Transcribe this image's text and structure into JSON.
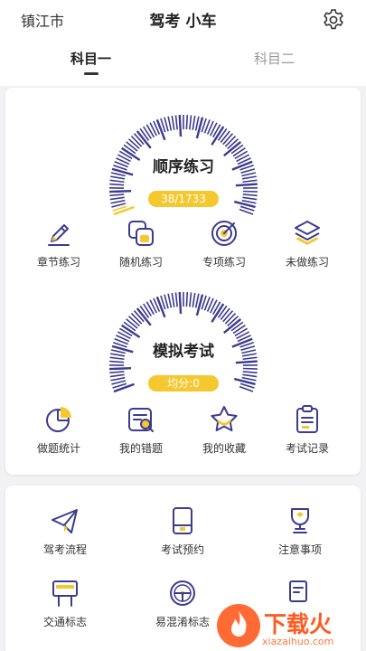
{
  "header": {
    "city": "镇江市",
    "title": "驾考 小车"
  },
  "tabs": [
    {
      "label": "科目一"
    },
    {
      "label": "科目二"
    }
  ],
  "practice": {
    "gauge_label": "顺序练习",
    "progress_text": "38/1733",
    "progress_fraction": 0.022,
    "items": [
      {
        "label": "章节练习"
      },
      {
        "label": "随机练习"
      },
      {
        "label": "专项练习"
      },
      {
        "label": "未做练习"
      }
    ]
  },
  "exam": {
    "gauge_label": "模拟考试",
    "score_text": "均分:0",
    "items": [
      {
        "label": "做题统计"
      },
      {
        "label": "我的错题"
      },
      {
        "label": "我的收藏"
      },
      {
        "label": "考试记录"
      }
    ]
  },
  "tools": {
    "items": [
      {
        "label": "驾考流程"
      },
      {
        "label": "考试预约"
      },
      {
        "label": "注意事项"
      },
      {
        "label": "交通标志"
      },
      {
        "label": "易混淆标志"
      }
    ]
  },
  "watermark": {
    "name": "下载火",
    "url": "xiazaihuo.com"
  },
  "colors": {
    "accent": "#f5c82f",
    "icon": "#3d3b8e",
    "watermark": "#ff5a1f"
  }
}
